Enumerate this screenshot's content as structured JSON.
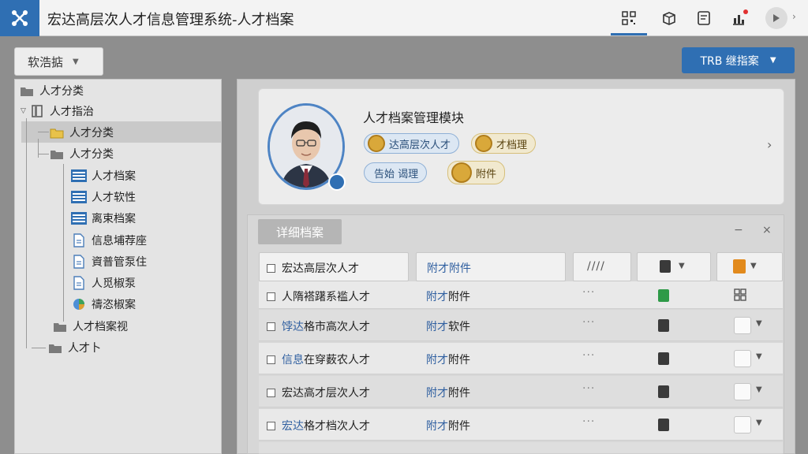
{
  "header": {
    "title": "宏达高层次人才信息管理系统-人才档案",
    "icons": [
      "qr-icon",
      "package-icon",
      "document-icon",
      "chart-upload-icon",
      "play-icon"
    ]
  },
  "sidebar": {
    "dropdown_label": "软浩掂",
    "tree": [
      {
        "label": "人才分类"
      },
      {
        "label": "人才指治"
      },
      {
        "label": "人才分类"
      },
      {
        "label": "人才分类"
      },
      {
        "label": "人才档案"
      },
      {
        "label": "人才软性"
      },
      {
        "label": "离束档案"
      },
      {
        "label": "信息埔荐座"
      },
      {
        "label": "資普管泵住"
      },
      {
        "label": "人觅椒泵"
      },
      {
        "label": "禱恣椒案"
      },
      {
        "label": "人才档案视"
      },
      {
        "label": "人才卜"
      }
    ]
  },
  "toolbar": {
    "primary_label": "TRB 继指案"
  },
  "profile": {
    "module_title": "人才档案管理模块",
    "tags": [
      {
        "label": "达高层次人才"
      },
      {
        "label": "才档理"
      },
      {
        "label": "告始 谒理"
      },
      {
        "label": "附件"
      }
    ]
  },
  "section": {
    "tab_label": "详细档案",
    "ctrl_minus": "−",
    "ctrl_x": "×"
  },
  "table": {
    "header": {
      "name": "宏达高层次人才",
      "file": "附才附件",
      "dots": "////"
    },
    "rows": [
      {
        "name_hl": "",
        "name": "人隋褡躇系褴人才",
        "file_lk": "附才",
        "file": "附件",
        "dots": "···",
        "type": "green"
      },
      {
        "name_hl": "饽达",
        "name": "格市高次人才",
        "file_lk": "附才",
        "file": "软件",
        "dots": "···",
        "type": "dark"
      },
      {
        "name_hl": "信息",
        "name": "在穿薮农人才",
        "file_lk": "附才",
        "file": "附件",
        "dots": "···",
        "type": "dark"
      },
      {
        "name_hl": "",
        "name": "宏达高才层次人才",
        "file_lk": "附才",
        "file": "附件",
        "dots": "···",
        "type": "dark"
      },
      {
        "name_hl": "宏达",
        "name": "格才档次人才",
        "file_lk": "附才",
        "file": "附件",
        "dots": "···",
        "type": "dark"
      }
    ]
  }
}
